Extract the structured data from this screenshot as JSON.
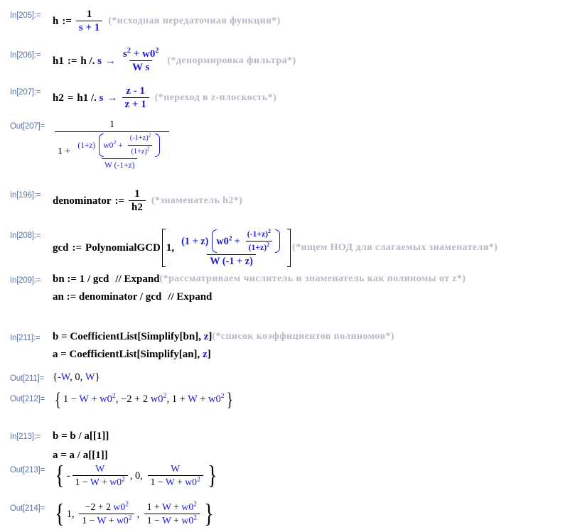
{
  "app": {
    "kind": "mathematica-notebook",
    "background": "#ffffff",
    "label_color": "#5c74a8",
    "variable_color": "#1a1ad6",
    "comment_color": "#b6b9c4",
    "text_color": "#000000"
  },
  "cells": [
    {
      "id": "in-205",
      "label": "In[205]:=",
      "kind": "input",
      "code": "h := 1/(s + 1)",
      "comment": "(*исходная передаточная функция*)",
      "parts": {
        "name": "h",
        "assign": ":=",
        "numerator": "1",
        "denominator": "s + 1"
      }
    },
    {
      "id": "in-206",
      "label": "In[206]:=",
      "kind": "input",
      "code": "h1 := h /. s -> (s^2 + w0^2)/(W s)",
      "comment": "(*денормировка фильтра*)",
      "parts": {
        "name": "h1",
        "assign": ":=",
        "lhs": "h /. s",
        "arrow": "→",
        "numerator": "s² + w0²",
        "denominator": "W s"
      }
    },
    {
      "id": "in-207",
      "label": "In[207]:=",
      "kind": "input",
      "code": "h2 = h1 /. s -> (z - 1)/(z + 1)",
      "comment": "(*переход в z-плоскость*)",
      "parts": {
        "name": "h2",
        "assign": "=",
        "lhs": "h1 /. s",
        "arrow": "→",
        "numerator": "z - 1",
        "denominator": "z + 1"
      }
    },
    {
      "id": "out-207",
      "label": "Out[207]=",
      "kind": "output",
      "expression": "1 / (1 + ((1+z)(w0^2 + (-1+z)^2/(1+z)^2))/(W (-1+z)))",
      "parts": {
        "outer_numerator": "1",
        "outer_den_lead": "1 +",
        "inner_num_left": "(1+z)",
        "inner_paren_first": "w0²",
        "inner_paren_plus": "+",
        "inner_frac_num": "(-1+z)²",
        "inner_frac_den": "(1+z)²",
        "inner_denominator": "W (-1+z)"
      }
    },
    {
      "id": "in-196",
      "label": "In[196]:=",
      "kind": "input",
      "code": "denominator := 1/h2",
      "comment": "(*знаменатель h2*)",
      "parts": {
        "name": "denominator",
        "assign": ":=",
        "numerator": "1",
        "denominator": "h2"
      }
    },
    {
      "id": "in-208",
      "label": "In[208]:=",
      "kind": "input",
      "code": "gcd := PolynomialGCD[1, ((1 + z)(w0^2 + (-1+z)^2/(1+z)^2))/(W (-1 + z))]",
      "comment": "(*ищем НОД для слагаемых знаменателя*)",
      "parts": {
        "name": "gcd",
        "assign": ":=",
        "function": "PolynomialGCD",
        "arg1": "1,",
        "frac_num_left": "(1 + z)",
        "paren_first": "w0²",
        "paren_plus": "+",
        "inner_frac_num": "(-1+z)²",
        "inner_frac_den": "(1+z)²",
        "frac_den": "W (-1 + z)"
      }
    },
    {
      "id": "in-209",
      "label": "In[209]:=",
      "kind": "input",
      "lines": [
        "bn := 1 / gcd  // Expand",
        "an := denominator / gcd  // Expand"
      ],
      "comment": "(*рассматриваем числитель и знаменатель как полиномы от z*)",
      "parts": {
        "line1_a": "bn := 1 / gcd",
        "line1_b": "// Expand",
        "line2_a": "an := denominator / gcd",
        "line2_b": "// Expand"
      }
    },
    {
      "id": "in-211",
      "label": "In[211]:=",
      "kind": "input",
      "lines": [
        "b = CoefficientList[Simplify[bn], z]",
        "a = CoefficientList[Simplify[an], z]"
      ],
      "comment": "(*список коэффициентов полиномов*)",
      "parts": {
        "line1": "b = CoefficientList[Simplify[bn], z]",
        "line2": "a = CoefficientList[Simplify[an], z]",
        "fn_outer": "CoefficientList",
        "fn_inner": "Simplify",
        "var": "z"
      }
    },
    {
      "id": "out-211",
      "label": "Out[211]=",
      "kind": "output",
      "list": [
        "-W",
        "0",
        "W"
      ],
      "expression": "{-W, 0, W}"
    },
    {
      "id": "out-212",
      "label": "Out[212]=",
      "kind": "output",
      "list": [
        "1 - W + w0²",
        "-2 + 2 w0²",
        "1 + W + w0²"
      ],
      "expression": "{1 - W + w0^2, -2 + 2 w0^2, 1 + W + w0^2}"
    },
    {
      "id": "in-213",
      "label": "In[213]:=",
      "kind": "input",
      "lines": [
        "b = b / a[[1]]",
        "a = a / a[[1]]"
      ],
      "parts": {
        "line1": "b = b / a[[1]]",
        "line2": "a = a / a[[1]]"
      }
    },
    {
      "id": "out-213",
      "label": "Out[213]=",
      "kind": "output",
      "expression": "{-W/(1 - W + w0^2), 0, W/(1 - W + w0^2)}",
      "items": [
        {
          "sign": "-",
          "num": "W",
          "den": "1 - W + w0²"
        },
        {
          "sign": "",
          "num": "0",
          "den": ""
        },
        {
          "sign": "",
          "num": "W",
          "den": "1 - W + w0²"
        }
      ]
    },
    {
      "id": "out-214",
      "label": "Out[214]=",
      "kind": "output",
      "expression": "{1, (-2 + 2 w0^2)/(1 - W + w0^2), (1 + W + w0^2)/(1 - W + w0^2)}",
      "items": [
        {
          "sign": "",
          "num": "1",
          "den": ""
        },
        {
          "sign": "",
          "num": "-2 + 2 w0²",
          "den": "1 - W + w0²"
        },
        {
          "sign": "",
          "num": "1 + W + w0²",
          "den": "1 - W + w0²"
        }
      ]
    }
  ],
  "symbols": {
    "comma": ",",
    "brace_open": "{",
    "brace_close": "}",
    "bracket_open": "[",
    "bracket_close": "]",
    "paren_open": "(",
    "paren_close": ")",
    "arrow": "→",
    "replace": "/.",
    "zero": "0",
    "one": "1",
    "plus": "+",
    "minus": "−"
  }
}
